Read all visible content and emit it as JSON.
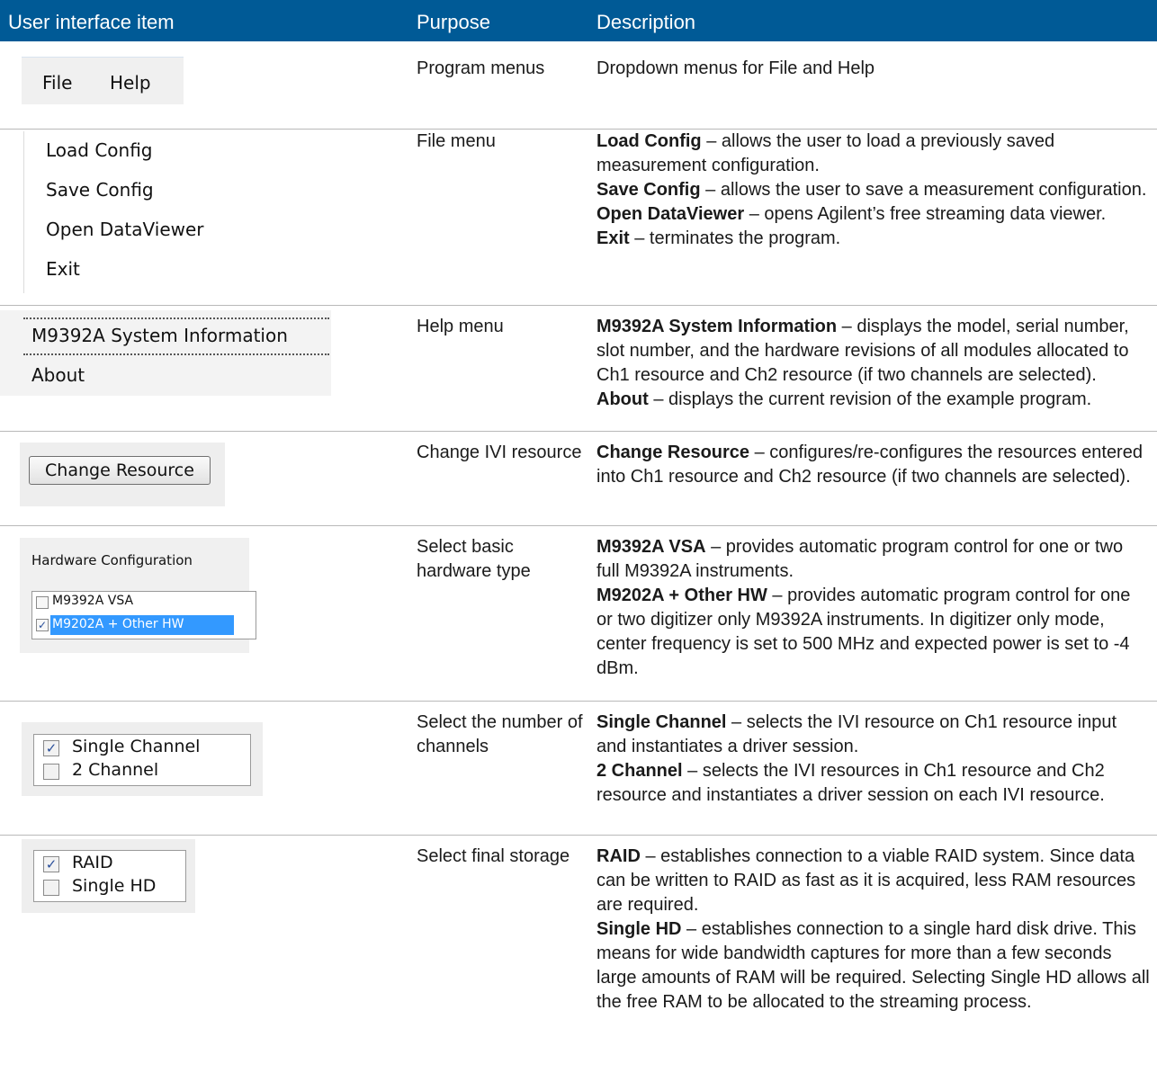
{
  "header": {
    "col1": "User interface item",
    "col2": "Purpose",
    "col3": "Description"
  },
  "colors": {
    "header_bg": "#005a96",
    "header_text": "#ffffff",
    "selection": "#3399ff"
  },
  "rows": [
    {
      "purpose": "Program menus",
      "description": [
        {
          "term": "",
          "text": "Dropdown menus for File and Help"
        }
      ],
      "screenshot": {
        "items": [
          "File",
          "Help"
        ]
      }
    },
    {
      "purpose": "File menu",
      "description": [
        {
          "term": "Load Config",
          "text": " – allows the user to load a previously saved measurement configuration."
        },
        {
          "term": "Save Config",
          "text": " – allows the user to save a measurement configuration."
        },
        {
          "term": "Open DataViewer",
          "text": " – opens Agilent’s free streaming data viewer."
        },
        {
          "term": "Exit",
          "text": " – terminates the program."
        }
      ],
      "screenshot": {
        "items": [
          "Load Config",
          "Save Config",
          "Open DataViewer",
          "Exit"
        ]
      }
    },
    {
      "purpose": "Help menu",
      "description": [
        {
          "term": "M9392A System Information",
          "text": " – displays the model, serial number, slot number, and the hardware revisions of all modules allocated to Ch1 resource and Ch2 resource (if two channels are selected)."
        },
        {
          "term": "About",
          "text": " – displays the current revision of the example program."
        }
      ],
      "screenshot": {
        "items": [
          "M9392A System Information",
          "About"
        ]
      }
    },
    {
      "purpose": "Change IVI resource",
      "description": [
        {
          "term": "Change Resource",
          "text": " – configures/re-configures the resources entered into Ch1 resource and Ch2 resource (if two channels are selected)."
        }
      ],
      "screenshot": {
        "button": "Change Resource"
      }
    },
    {
      "purpose": "Select basic hardware type",
      "description": [
        {
          "term": "M9392A VSA",
          "text": " – provides automatic program control for one or two full M9392A instruments."
        },
        {
          "term": "M9202A + Other HW",
          "text": " – provides automatic program control for one or two digitizer only M9392A instruments. In digitizer only mode, center frequency is set to 500 MHz and expected power is set to -4 dBm."
        }
      ],
      "screenshot": {
        "title": "Hardware Configuration",
        "options": [
          {
            "label": "M9392A VSA",
            "checked": false
          },
          {
            "label": "M9202A + Other HW",
            "checked": true
          }
        ],
        "check": "✓"
      }
    },
    {
      "purpose": "Select the number of channels",
      "description": [
        {
          "term": "Single Channel",
          "text": " – selects the IVI resource on Ch1 resource input and instantiates a driver session."
        },
        {
          "term": "2 Channel",
          "text": " – selects the IVI resources in Ch1 resource and Ch2 resource and instantiates a driver session on each IVI resource."
        }
      ],
      "screenshot": {
        "options": [
          {
            "label": "Single Channel",
            "checked": true
          },
          {
            "label": "2 Channel",
            "checked": false
          }
        ],
        "check": "✓"
      }
    },
    {
      "purpose": "Select final storage",
      "description": [
        {
          "term": "RAID",
          "text": " – establishes connection to a viable RAID system. Since data can be written to RAID as fast as it is acquired, less RAM resources are required."
        },
        {
          "term": "Single HD",
          "text": " – establishes connection to a single hard disk drive. This means for wide bandwidth captures for more than a few seconds large amounts of RAM will be required. Selecting Single HD allows all the free RAM to be allocated to the streaming process."
        }
      ],
      "screenshot": {
        "options": [
          {
            "label": "RAID",
            "checked": true
          },
          {
            "label": "Single HD",
            "checked": false
          }
        ],
        "check": "✓"
      }
    }
  ]
}
